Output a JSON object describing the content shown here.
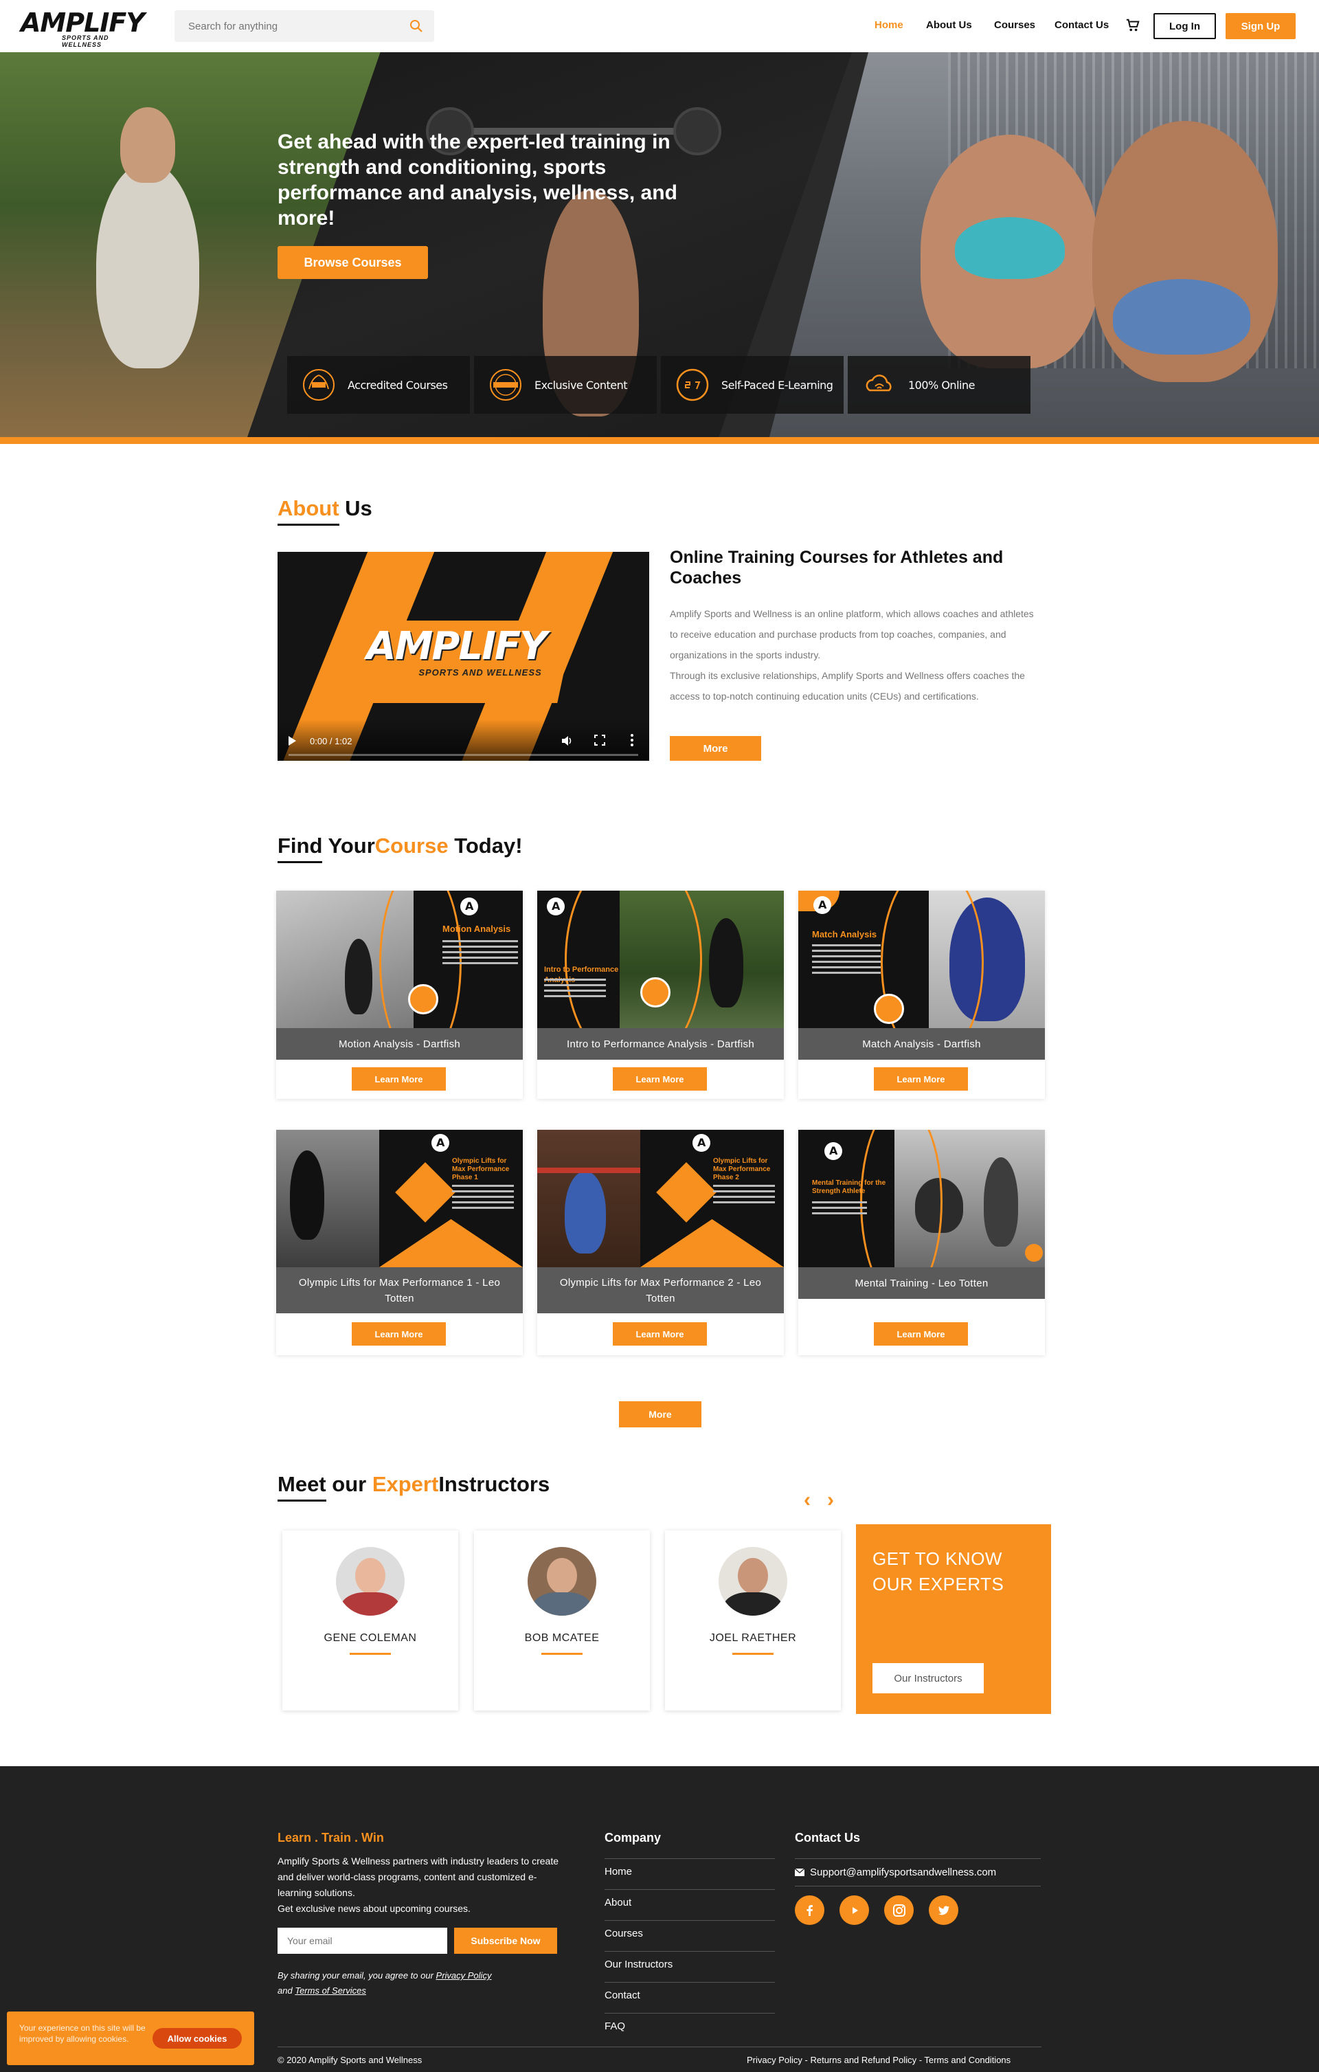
{
  "brand": {
    "name": "AMPLIFY",
    "tagline": "SPORTS AND WELLNESS",
    "accent": "#f7901e"
  },
  "header": {
    "search_placeholder": "Search for anything",
    "nav": [
      "Home",
      "About Us",
      "Courses",
      "Contact Us"
    ],
    "active": "Home",
    "login": "Log In",
    "signup": "Sign Up",
    "cart_icon": "cart-icon"
  },
  "hero": {
    "title": "Get ahead with the expert-led training in strength and conditioning, sports performance and analysis, wellness, and more!",
    "cta": "Browse Courses",
    "features": [
      {
        "label": "Accredited Courses",
        "icon": "laurel-icon"
      },
      {
        "label": "Exclusive Content",
        "icon": "exclusive-badge-icon"
      },
      {
        "label": "Self-Paced E-Learning",
        "icon": "24-7-icon"
      },
      {
        "label": "100% Online",
        "icon": "cloud-wifi-icon"
      }
    ]
  },
  "about": {
    "title_highlight": "About",
    "title_rest": "Us",
    "heading": "Online Training Courses for Athletes and Coaches",
    "paragraph": "Amplify Sports and Wellness is an online platform, which allows coaches and athletes to receive education and purchase products from top coaches, companies, and organizations in the sports industry.",
    "paragraph2": "Through its exclusive relationships, Amplify Sports and Wellness offers coaches the access to top-notch continuing education units (CEUs) and certifications.",
    "more": "More",
    "video": {
      "logo": "AMPLIFY",
      "logo_sub": "SPORTS AND WELLNESS",
      "time": "0:00 / 1:02"
    }
  },
  "courses": {
    "title_a": "Find",
    "title_b": "Your",
    "title_c": "Course",
    "title_d": "Today!",
    "items": [
      {
        "title": "Motion Analysis - Dartfish",
        "button": "Learn More",
        "thumb_title": "Motion Analysis"
      },
      {
        "title": "Intro to Performance Analysis - Dartfish",
        "button": "Learn More",
        "thumb_title": "Intro to Performance Analysis"
      },
      {
        "title": "Match Analysis - Dartfish",
        "button": "Learn More",
        "thumb_title": "Match Analysis"
      },
      {
        "title": "Olympic Lifts for Max Performance 1 - Leo Totten",
        "button": "Learn More",
        "thumb_title": "Olympic Lifts for Max Performance Phase 1"
      },
      {
        "title": "Olympic Lifts for Max Performance 2 - Leo Totten",
        "button": "Learn More",
        "thumb_title": "Olympic Lifts for Max Performance Phase 2"
      },
      {
        "title": "Mental Training - Leo Totten",
        "button": "Learn More",
        "thumb_title": "Mental Training for the Strength Athlete"
      }
    ],
    "more": "More"
  },
  "instructors": {
    "title_a": "Meet",
    "title_b": "our",
    "title_c": "Expert",
    "title_d": "Instructors",
    "prev": "‹",
    "next": "›",
    "people": [
      {
        "name": "GENE COLEMAN"
      },
      {
        "name": "BOB MCATEE"
      },
      {
        "name": "JOEL RAETHER"
      }
    ],
    "cta_title": "GET TO KNOW OUR EXPERTS",
    "cta_button": "Our Instructors"
  },
  "footer": {
    "tagline": "Learn . Train . Win",
    "description": "Amplify Sports & Wellness partners with industry leaders to create and deliver world-class programs, content and customized e-learning solutions.",
    "description2": "Get exclusive news about upcoming courses.",
    "email_placeholder": "Your email",
    "subscribe": "Subscribe Now",
    "agree_a": "By sharing your email, you agree to our",
    "privacy": "Privacy Policy",
    "agree_b": "and",
    "terms": "Terms of Services",
    "company_head": "Company",
    "company_links": [
      "Home",
      "About",
      "Courses",
      "Our Instructors",
      "Contact",
      "FAQ"
    ],
    "contact_head": "Contact Us",
    "email": "Support@amplifysportsandwellness.com",
    "socials": [
      "facebook-icon",
      "youtube-icon",
      "instagram-icon",
      "twitter-icon"
    ],
    "copyright": "© 2020 Amplify Sports and Wellness",
    "legal": "Privacy Policy - Returns and Refund Policy - Terms and Conditions"
  },
  "cookie": {
    "text": "Your experience on this site will be improved by allowing cookies.",
    "button": "Allow cookies"
  }
}
